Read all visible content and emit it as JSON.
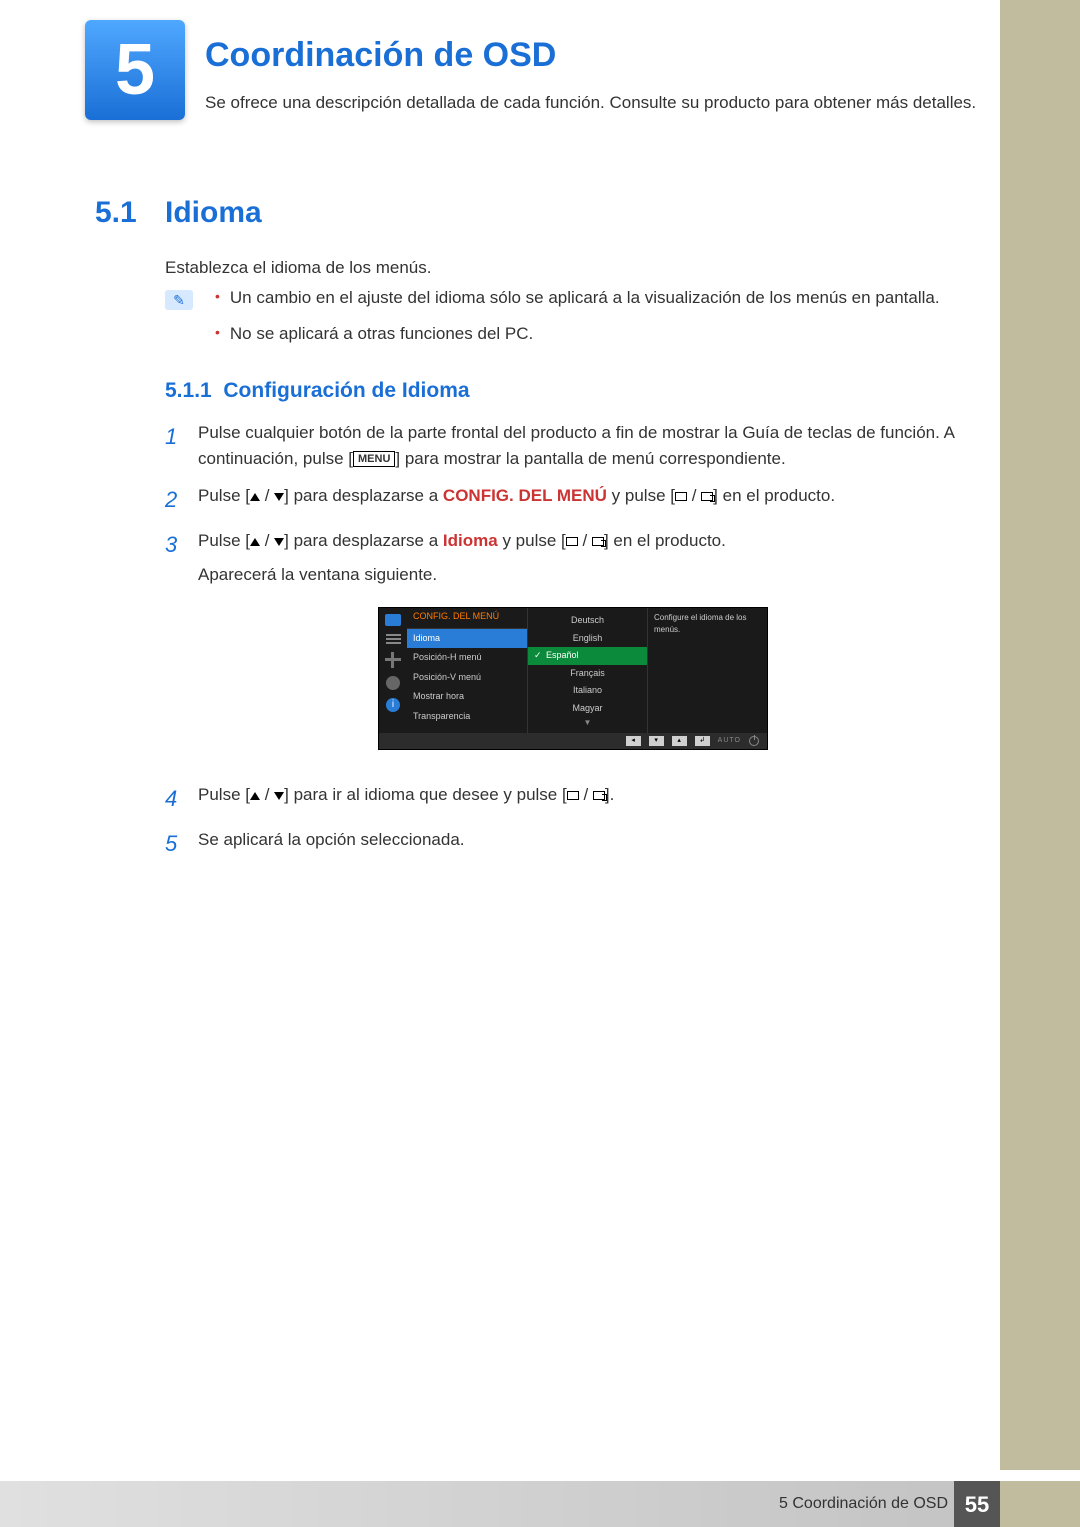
{
  "chapter": {
    "number": "5",
    "title": "Coordinación de OSD",
    "subtitle": "Se ofrece una descripción detallada de cada función. Consulte su producto para obtener más detalles."
  },
  "section": {
    "number": "5.1",
    "title": "Idioma",
    "intro": "Establezca el idioma de los menús."
  },
  "notes": {
    "n1": "Un cambio en el ajuste del idioma sólo se aplicará a la visualización de los menús en pantalla.",
    "n2": "No se aplicará a otras funciones del PC."
  },
  "subsection": {
    "number": "5.1.1",
    "title": "Configuración de Idioma"
  },
  "steps": {
    "s1a": "Pulse cualquier botón de la parte frontal del producto a fin de mostrar la Guía de teclas de función. A continuación, pulse [",
    "s1b": "] para mostrar la pantalla de menú correspondiente.",
    "menu_label": "MENU",
    "s2a": "Pulse [",
    "s2b": "] para desplazarse a ",
    "s2c": " y pulse [",
    "s2d": "] en el producto.",
    "config_menu": "CONFIG. DEL MENÚ",
    "s3a": "Pulse [",
    "s3b": "] para desplazarse a ",
    "s3c": " y pulse [",
    "s3d": "] en el producto.",
    "idioma_word": "Idioma",
    "s3e": "Aparecerá la ventana siguiente.",
    "s4a": "Pulse [",
    "s4b": "] para ir al idioma que desee y pulse [",
    "s4c": "].",
    "s5": "Se aplicará la opción seleccionada."
  },
  "osd": {
    "header": "CONFIG. DEL MENÚ",
    "items": {
      "i0": "Idioma",
      "i1": "Posición-H menú",
      "i2": "Posición-V menú",
      "i3": "Mostrar hora",
      "i4": "Transparencia"
    },
    "langs": {
      "l0": "Deutsch",
      "l1": "English",
      "l2": "Español",
      "l3": "Français",
      "l4": "Italiano",
      "l5": "Magyar"
    },
    "desc": "Configure el idioma de los menús.",
    "footer_auto": "AUTO"
  },
  "footer": {
    "chapter_label": "5 Coordinación de OSD",
    "page": "55"
  }
}
